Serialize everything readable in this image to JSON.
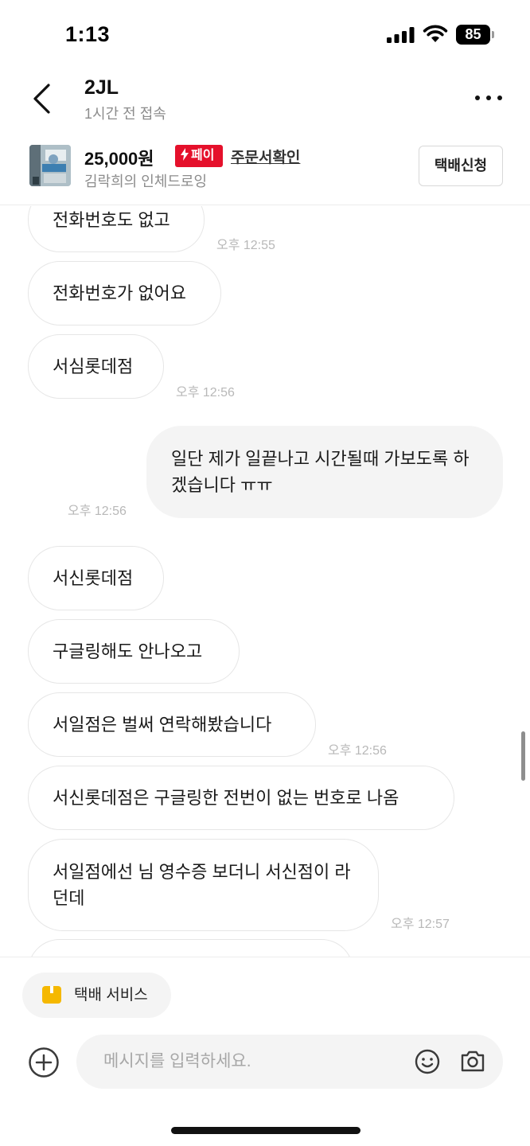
{
  "status_bar": {
    "time": "1:13",
    "battery": "85"
  },
  "header": {
    "name": "2JL",
    "last_seen": "1시간 전 접속",
    "back_icon": "chevron-left-icon",
    "more_icon": "more-horizontal-icon"
  },
  "product": {
    "price": "25,000원",
    "pay_badge": "페이",
    "order_link": "주문서확인",
    "title": "김락희의 인체드로잉",
    "delivery_button": "택배신청"
  },
  "messages": [
    {
      "text": "전화번호도 없고",
      "sender": "other",
      "time": "오후 12:55"
    },
    {
      "text": "전화번호가 없어요",
      "sender": "other",
      "time": ""
    },
    {
      "text": "서심롯데점",
      "sender": "other",
      "time": "오후 12:56"
    },
    {
      "text": "일단 제가 일끝나고 시간될때 가보도록 하겠습니다 ㅠㅠ",
      "sender": "me",
      "time": "오후 12:56"
    },
    {
      "text": "서신롯데점",
      "sender": "other",
      "time": ""
    },
    {
      "text": "구글링해도 안나오고",
      "sender": "other",
      "time": ""
    },
    {
      "text": "서일점은 벌써 연락해봤습니다",
      "sender": "other",
      "time": "오후 12:56"
    },
    {
      "text": "서신롯데점은 구글링한 전번이 없는 번호로 나옴",
      "sender": "other",
      "time": ""
    },
    {
      "text": "서일점에선 님 영수증 보더니 서신점이 라던데",
      "sender": "other",
      "time": "오후 12:57"
    },
    {
      "text": "",
      "sender": "other",
      "time": ""
    }
  ],
  "footer": {
    "service_chip": "택배 서비스",
    "input_placeholder": "메시지를 입력하세요.",
    "add_icon": "plus-circle-icon",
    "emoji_icon": "smile-icon",
    "camera_icon": "camera-icon"
  },
  "colors": {
    "pay_red": "#e5102b",
    "my_bubble": "#f4f4f4",
    "timestamp": "#b8b8b8",
    "service_icon": "#f5b800"
  }
}
